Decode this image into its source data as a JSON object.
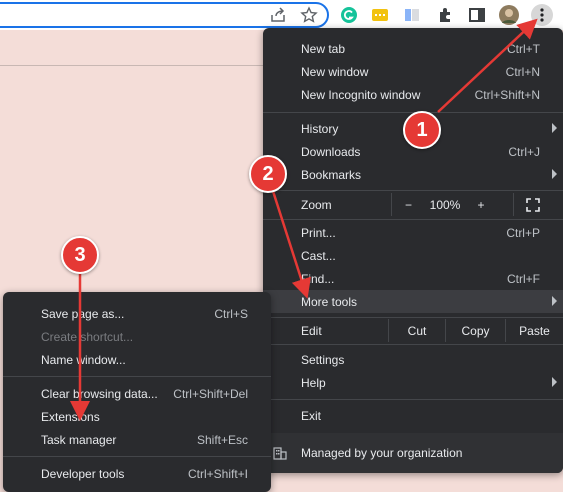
{
  "colors": {
    "page_bg": "#f4ddd8",
    "menu_bg": "#2a2b2e",
    "menu_text": "#e8eaed",
    "shortcut_text": "#bdc1c6",
    "annotation": "#e53935",
    "omnibox_border": "#1a73e8"
  },
  "toolbar": {
    "icons": [
      "share-icon",
      "star-icon",
      "grammarly-icon",
      "extension-yellow-icon",
      "extension-book-icon",
      "puzzle-icon",
      "sidepanel-icon",
      "profile-avatar",
      "kebab-menu-icon"
    ]
  },
  "main_menu": {
    "new_tab": {
      "label": "New tab",
      "shortcut": "Ctrl+T"
    },
    "new_window": {
      "label": "New window",
      "shortcut": "Ctrl+N"
    },
    "new_incognito": {
      "label": "New Incognito window",
      "shortcut": "Ctrl+Shift+N"
    },
    "history": {
      "label": "History"
    },
    "downloads": {
      "label": "Downloads",
      "shortcut": "Ctrl+J"
    },
    "bookmarks": {
      "label": "Bookmarks"
    },
    "zoom": {
      "label": "Zoom",
      "minus": "−",
      "value": "100%",
      "plus": "+"
    },
    "print": {
      "label": "Print...",
      "shortcut": "Ctrl+P"
    },
    "cast": {
      "label": "Cast..."
    },
    "find": {
      "label": "Find...",
      "shortcut": "Ctrl+F"
    },
    "more_tools": {
      "label": "More tools"
    },
    "edit": {
      "label": "Edit",
      "cut": "Cut",
      "copy": "Copy",
      "paste": "Paste"
    },
    "settings": {
      "label": "Settings"
    },
    "help": {
      "label": "Help"
    },
    "exit": {
      "label": "Exit"
    },
    "managed": {
      "label": "Managed by your organization"
    }
  },
  "sub_menu": {
    "save_page": {
      "label": "Save page as...",
      "shortcut": "Ctrl+S"
    },
    "create_shortcut": {
      "label": "Create shortcut..."
    },
    "name_window": {
      "label": "Name window..."
    },
    "clear_browsing": {
      "label": "Clear browsing data...",
      "shortcut": "Ctrl+Shift+Del"
    },
    "extensions": {
      "label": "Extensions"
    },
    "task_manager": {
      "label": "Task manager",
      "shortcut": "Shift+Esc"
    },
    "developer_tools": {
      "label": "Developer tools",
      "shortcut": "Ctrl+Shift+I"
    }
  },
  "annotations": {
    "step1": "1",
    "step2": "2",
    "step3": "3"
  }
}
